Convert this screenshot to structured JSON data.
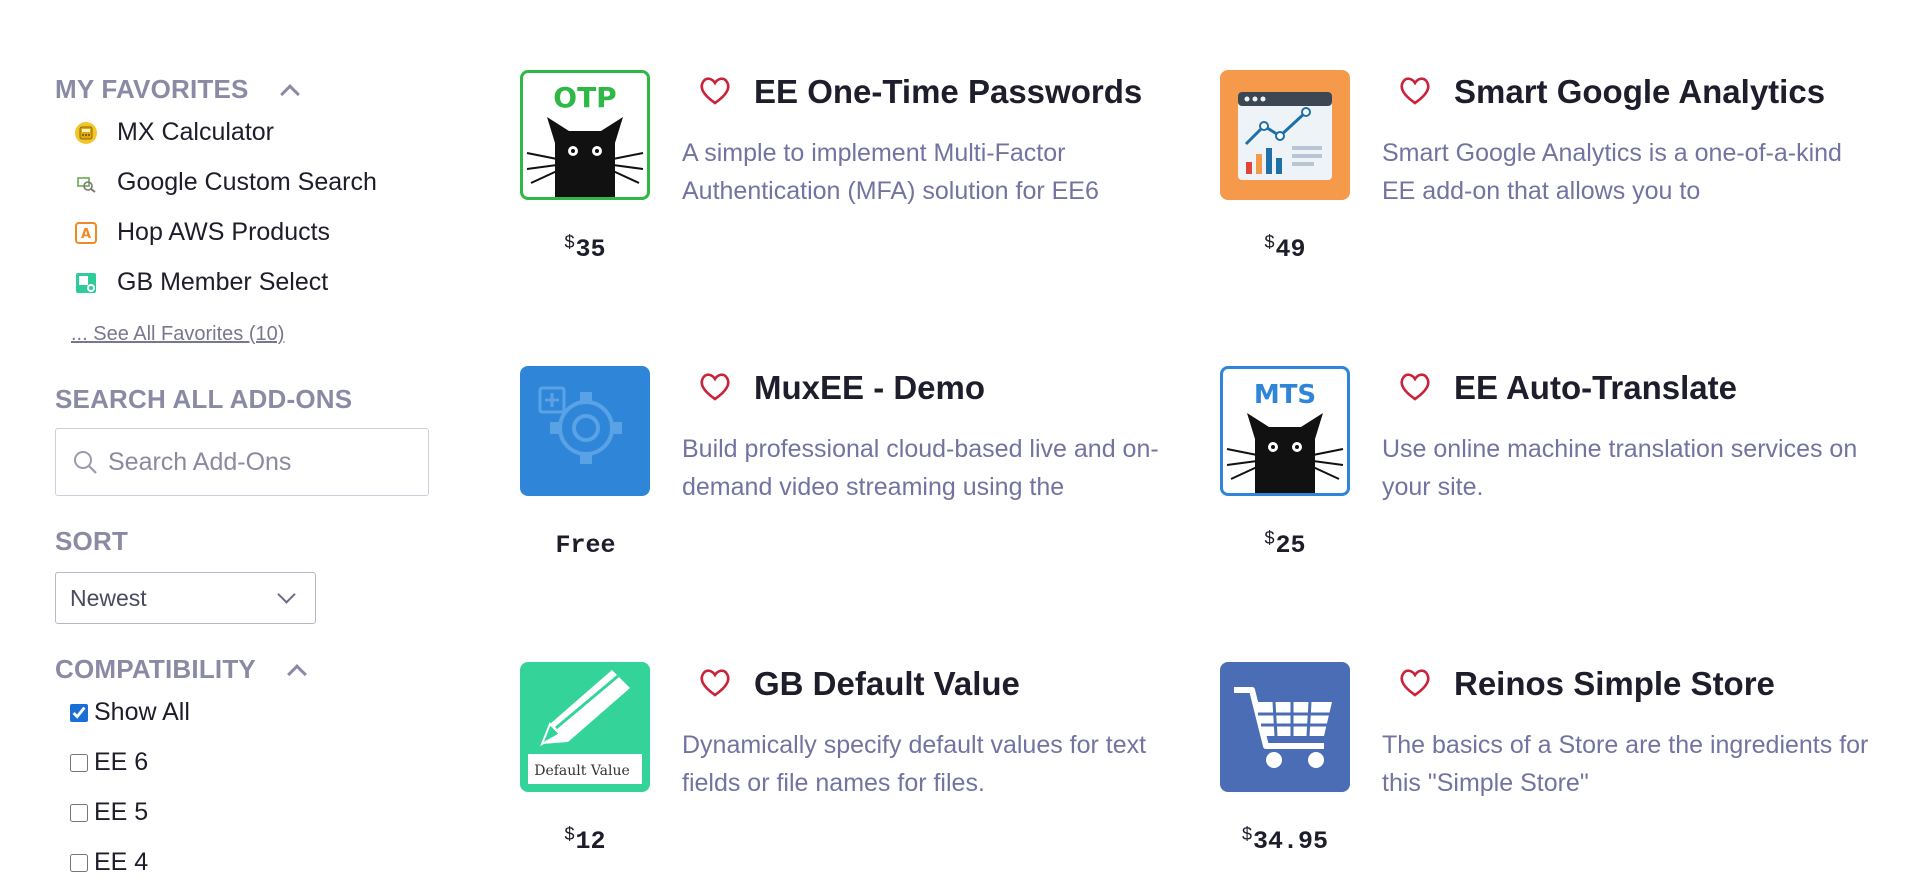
{
  "sidebar": {
    "favorites_heading": "MY FAVORITES",
    "favorites": [
      {
        "label": "MX Calculator",
        "icon": "calculator-icon"
      },
      {
        "label": "Google Custom Search",
        "icon": "search-engine-icon"
      },
      {
        "label": "Hop AWS Products",
        "icon": "amazon-icon"
      },
      {
        "label": "GB Member Select",
        "icon": "member-select-icon"
      }
    ],
    "see_all": "... See All Favorites (10)",
    "search_heading": "SEARCH ALL ADD-ONS",
    "search_placeholder": "Search Add-Ons",
    "sort_heading": "SORT",
    "sort_value": "Newest",
    "compat_heading": "COMPATIBILITY",
    "compat_options": [
      {
        "label": "Show All",
        "checked": true
      },
      {
        "label": "EE 6",
        "checked": false
      },
      {
        "label": "EE 5",
        "checked": false
      },
      {
        "label": "EE 4",
        "checked": false
      }
    ]
  },
  "addons": [
    {
      "title": "EE One-Time Passwords",
      "description": "A simple to implement Multi-Factor Authentication (MFA) solution for EE6",
      "currency": "$",
      "price": "35",
      "thumb": "otp-cat-icon",
      "thumb_label": "OTP"
    },
    {
      "title": "Smart Google Analytics",
      "description": "Smart Google Analytics is a one-of-a-kind EE add-on that allows you to",
      "currency": "$",
      "price": "49",
      "thumb": "analytics-chart-icon"
    },
    {
      "title": "MuxEE - Demo",
      "description": "Build professional cloud-based live and on-demand video streaming using the",
      "currency": "",
      "price": "Free",
      "thumb": "gear-icon"
    },
    {
      "title": "EE Auto-Translate",
      "description": "Use online machine translation services on your site.",
      "currency": "$",
      "price": "25",
      "thumb": "mts-cat-icon",
      "thumb_label": "MTS"
    },
    {
      "title": "GB Default Value",
      "description": "Dynamically specify default values for text fields or file names for files.",
      "currency": "$",
      "price": "12",
      "thumb": "pencil-icon",
      "thumb_label": "Default Value"
    },
    {
      "title": "Reinos Simple Store",
      "description": "The basics of a Store are the ingredients for this \"Simple Store\"",
      "currency": "$",
      "price": "34.95",
      "thumb": "shopping-cart-icon"
    }
  ],
  "colors": {
    "heading": "#8a8aa5",
    "description": "#7373a2",
    "heart": "#c8233a",
    "otp_border": "#2fb845",
    "analytics_bg": "#f59a4a",
    "muxee_bg": "#2f86d9",
    "mts_border": "#2f86d9",
    "default_value_bg": "#34d399",
    "store_bg": "#4a6db5"
  }
}
